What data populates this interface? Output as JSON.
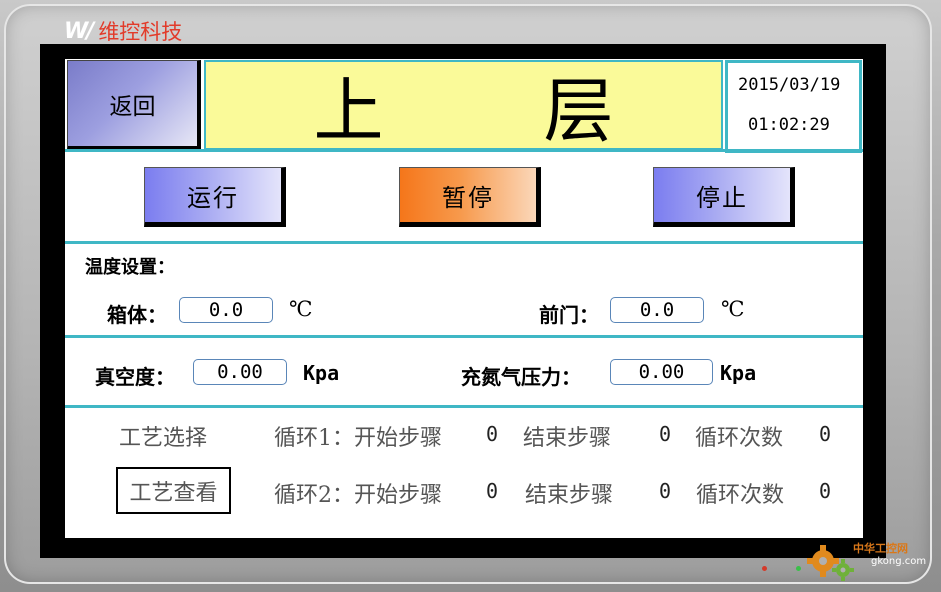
{
  "brand": {
    "mark": "W/",
    "name": "维控科技"
  },
  "header": {
    "back_label": "返回",
    "title_chars": [
      "上",
      "层"
    ],
    "date": "2015/03/19",
    "time": "01:02:29"
  },
  "controls": {
    "run": "运行",
    "pause": "暂停",
    "stop": "停止"
  },
  "temperature": {
    "section_label": "温度设置：",
    "box_label": "箱体：",
    "box_value": "0.0",
    "door_label": "前门：",
    "door_value": "0.0",
    "unit": "℃"
  },
  "pressure": {
    "vacuum_label": "真空度：",
    "vacuum_value": "0.00",
    "nitrogen_label": "充氮气压力：",
    "nitrogen_value": "0.00",
    "unit": "Kpa"
  },
  "process": {
    "select_label": "工艺选择",
    "view_label": "工艺查看",
    "loops": [
      {
        "loop_label": "循环1：开始步骤",
        "start_value": "0",
        "end_label": "结束步骤",
        "end_value": "0",
        "count_label": "循环次数",
        "count_value": "0"
      },
      {
        "loop_label": "循环2：开始步骤",
        "start_value": "0",
        "end_label": "结束步骤",
        "end_value": "0",
        "count_label": "循环次数",
        "count_value": "0"
      }
    ]
  },
  "watermark": {
    "name": "中华工控网",
    "url": "gkong.com"
  },
  "colors": {
    "accent": "#3fb7c5",
    "title_bg": "#fafa99",
    "button_blue": "#7b7df0",
    "button_orange": "#f5761a",
    "brand_red": "#e23b2a"
  }
}
